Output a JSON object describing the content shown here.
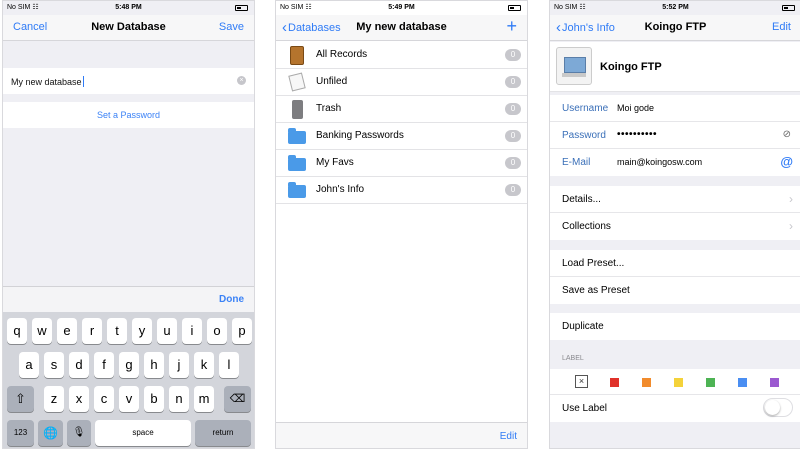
{
  "screen1": {
    "status": {
      "carrier": "No SIM",
      "time": "5:48 PM"
    },
    "nav": {
      "left": "Cancel",
      "title": "New Database",
      "right": "Save"
    },
    "name_field": {
      "value": "My new database"
    },
    "set_password": "Set a Password",
    "keyboard": {
      "done": "Done",
      "row1": [
        "q",
        "w",
        "e",
        "r",
        "t",
        "y",
        "u",
        "i",
        "o",
        "p"
      ],
      "row2": [
        "a",
        "s",
        "d",
        "f",
        "g",
        "h",
        "j",
        "k",
        "l"
      ],
      "row3": [
        "z",
        "x",
        "c",
        "v",
        "b",
        "n",
        "m"
      ],
      "num_key": "123",
      "space": "space",
      "return": "return"
    }
  },
  "screen2": {
    "status": {
      "carrier": "No SIM",
      "time": "5:49 PM"
    },
    "nav": {
      "back": "Databases",
      "title": "My new database",
      "add": "+"
    },
    "items": [
      {
        "label": "All Records",
        "count": "0",
        "icon": "cabinet-icon"
      },
      {
        "label": "Unfiled",
        "count": "0",
        "icon": "papers-icon"
      },
      {
        "label": "Trash",
        "count": "0",
        "icon": "trash-icon"
      },
      {
        "label": "Banking Passwords",
        "count": "0",
        "icon": "folder-icon"
      },
      {
        "label": "My Favs",
        "count": "0",
        "icon": "folder-icon"
      },
      {
        "label": "John's Info",
        "count": "0",
        "icon": "folder-icon"
      }
    ],
    "toolbar": {
      "edit": "Edit"
    }
  },
  "screen3": {
    "status": {
      "carrier": "No SIM",
      "time": "5:52 PM"
    },
    "nav": {
      "back": "John's Info",
      "title": "Koingo FTP",
      "right": "Edit"
    },
    "record_title": "Koingo FTP",
    "fields": {
      "username_label": "Username",
      "username_value": "Moi gode",
      "password_label": "Password",
      "password_value": "••••••••••",
      "email_label": "E-Mail",
      "email_value": "main@koingosw.com"
    },
    "details": "Details...",
    "collections": "Collections",
    "load_preset": "Load Preset...",
    "save_preset": "Save as Preset",
    "duplicate": "Duplicate",
    "label_section": "LABEL",
    "label_colors": [
      "#e0312a",
      "#f18b2c",
      "#f4d23a",
      "#4db354",
      "#4a8ef2",
      "#9b59d0"
    ],
    "use_label": "Use Label"
  }
}
